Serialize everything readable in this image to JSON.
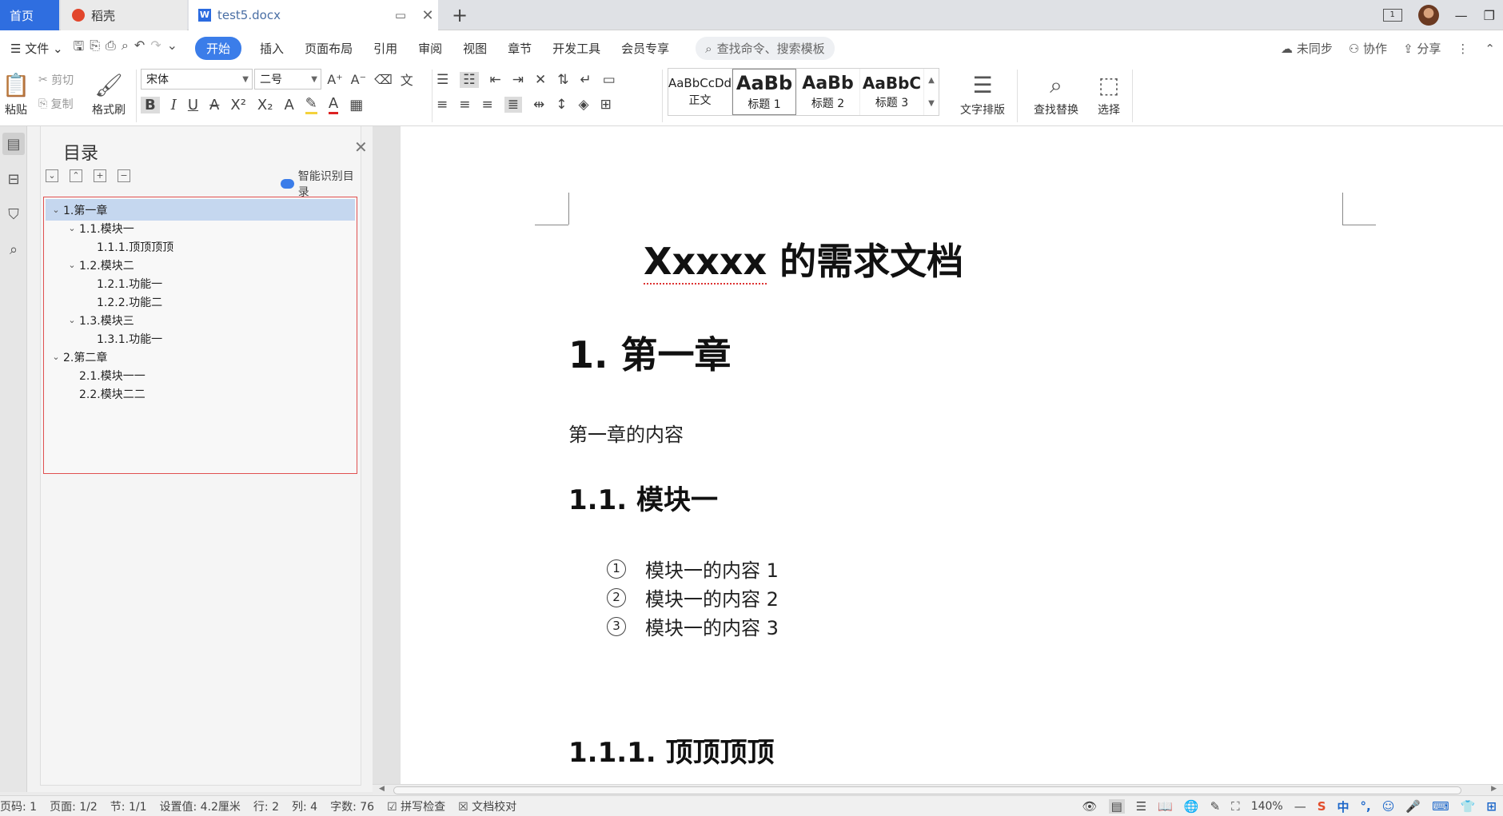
{
  "tabs": {
    "home": "首页",
    "daoke": "稻壳",
    "doc": "test5.docx"
  },
  "menu": {
    "file": "文件",
    "items": [
      "开始",
      "插入",
      "页面布局",
      "引用",
      "审阅",
      "视图",
      "章节",
      "开发工具",
      "会员专享"
    ],
    "search_placeholder": "查找命令、搜索模板",
    "sync": "未同步",
    "collab": "协作",
    "share": "分享"
  },
  "ribbon": {
    "paste": "粘贴",
    "cut": "剪切",
    "copy": "复制",
    "format_painter": "格式刷",
    "font_name": "宋体",
    "font_size": "二号",
    "styles": [
      {
        "preview": "AaBbCcDd",
        "label": "正文"
      },
      {
        "preview": "AaBb",
        "label": "标题 1"
      },
      {
        "preview": "AaBb",
        "label": "标题 2"
      },
      {
        "preview": "AaBbC",
        "label": "标题 3"
      }
    ],
    "text_layout": "文字排版",
    "find_replace": "查找替换",
    "select": "选择"
  },
  "nav": {
    "title": "目录",
    "smart": "智能识别目录",
    "items": [
      {
        "label": "1.第一章",
        "level": 0,
        "expanded": true,
        "active": true
      },
      {
        "label": "1.1.模块一",
        "level": 1,
        "expanded": true
      },
      {
        "label": "1.1.1.顶顶顶顶",
        "level": 2
      },
      {
        "label": "1.2.模块二",
        "level": 1,
        "expanded": true
      },
      {
        "label": "1.2.1.功能一",
        "level": 2
      },
      {
        "label": "1.2.2.功能二",
        "level": 2
      },
      {
        "label": "1.3.模块三",
        "level": 1,
        "expanded": true
      },
      {
        "label": "1.3.1.功能一",
        "level": 2
      },
      {
        "label": "2.第二章",
        "level": 0,
        "expanded": true
      },
      {
        "label": "2.1.模块一一",
        "level": 1
      },
      {
        "label": "2.2.模块二二",
        "level": 1
      }
    ]
  },
  "document": {
    "title_a": "Xxxxx",
    "title_b": " 的需求文档",
    "h1": "1. 第一章",
    "p1": "第一章的内容",
    "h2": "1.1. 模块一",
    "list": [
      {
        "num": "1",
        "text": "模块一的内容 1"
      },
      {
        "num": "2",
        "text": "模块一的内容 2"
      },
      {
        "num": "3",
        "text": "模块一的内容 3"
      }
    ],
    "h3": "1.1.1. 顶顶顶顶"
  },
  "status": {
    "page_code": "页码: 1",
    "page": "页面: 1/2",
    "section": "节: 1/1",
    "setting": "设置值: 4.2厘米",
    "row": "行: 2",
    "col": "列: 4",
    "words": "字数: 76",
    "spell": "拼写检查",
    "proof": "文档校对",
    "zoom": "140%",
    "ime": "中"
  }
}
